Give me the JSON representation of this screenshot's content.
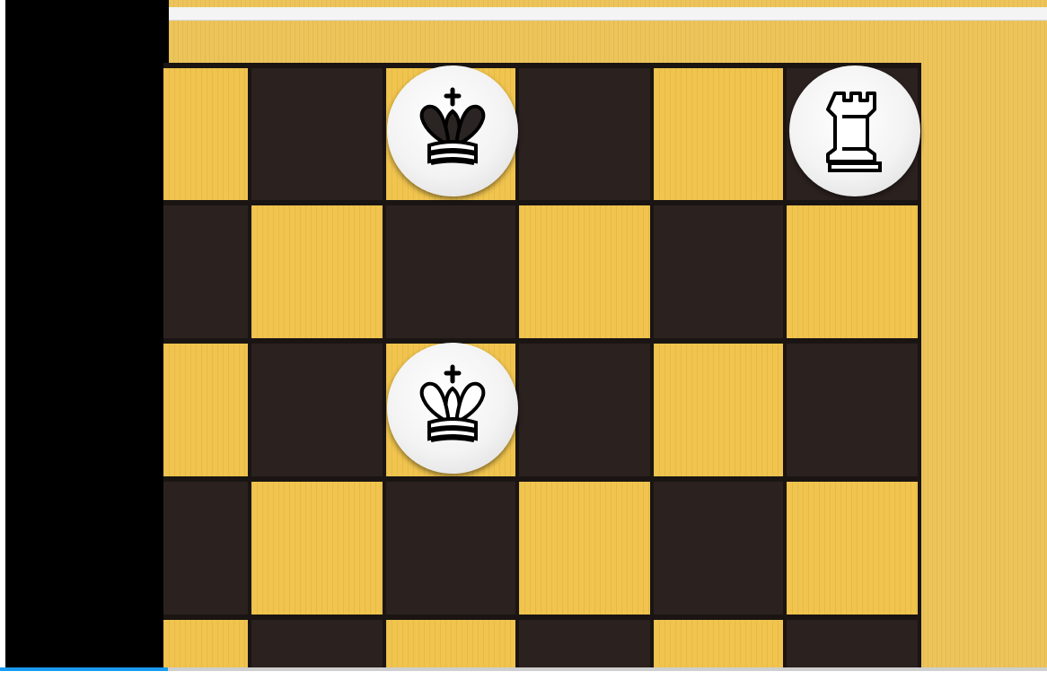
{
  "board": {
    "visible_files": 6,
    "visible_ranks": 5,
    "light_color": "#f0c44e",
    "dark_color": "#2b211f",
    "pieces": [
      {
        "name": "black-king",
        "glyph": "king",
        "color": "black",
        "file": 2,
        "rank": 0
      },
      {
        "name": "white-rook",
        "glyph": "rook",
        "color": "white",
        "file": 5,
        "rank": 0
      },
      {
        "name": "white-king",
        "glyph": "king",
        "color": "white",
        "file": 2,
        "rank": 2
      }
    ]
  },
  "video": {
    "progress_fraction": 0.16,
    "progress_color": "#1a9bf0"
  }
}
